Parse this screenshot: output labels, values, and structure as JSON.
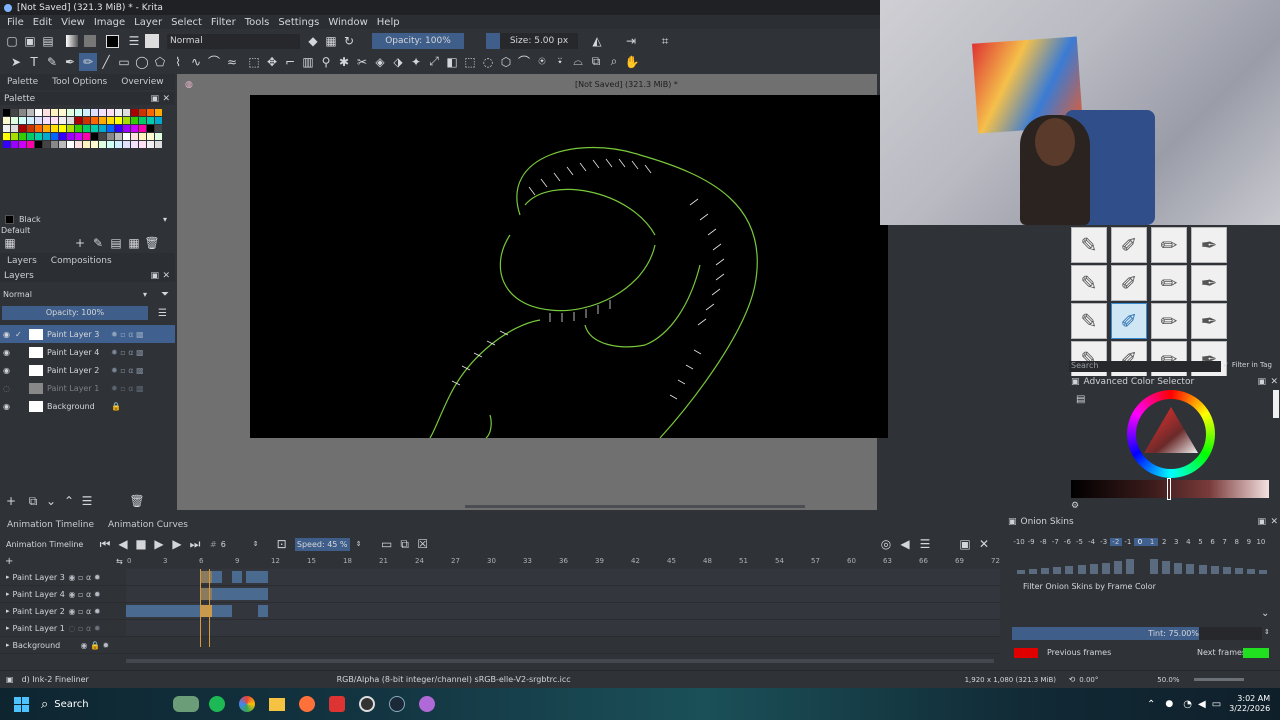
{
  "window": {
    "title": "[Not Saved]  (321.3 MiB) * - Krita"
  },
  "menu": [
    "File",
    "Edit",
    "View",
    "Image",
    "Layer",
    "Select",
    "Filter",
    "Tools",
    "Settings",
    "Window",
    "Help"
  ],
  "toolbar": {
    "blend_mode": "Normal",
    "opacity": "Opacity: 100%",
    "size": "Size: 5.00 px"
  },
  "docker_tabs": [
    "Palette",
    "Tool Options",
    "Overview"
  ],
  "palette": {
    "title": "Palette",
    "current_color": "Black",
    "palette_name": "Default"
  },
  "canvas": {
    "title": "[Not Saved]  (321.3 MiB) *"
  },
  "layers": {
    "tabs": [
      "Layers",
      "Compositions"
    ],
    "blend_mode": "Normal",
    "opacity": "Opacity: 100%",
    "items": [
      {
        "name": "Paint Layer 3",
        "selected": true
      },
      {
        "name": "Paint Layer 4",
        "selected": false
      },
      {
        "name": "Paint Layer 2",
        "selected": false
      },
      {
        "name": "Paint Layer 1",
        "selected": false
      },
      {
        "name": "Background",
        "selected": false
      }
    ]
  },
  "timeline": {
    "tabs": [
      "Animation Timeline",
      "Animation Curves"
    ],
    "title": "Animation Timeline",
    "frame": "6",
    "speed": "Speed: 45 %",
    "ruler": [
      "0",
      "3",
      "6",
      "9",
      "12",
      "15",
      "18",
      "21",
      "24",
      "27",
      "30",
      "33",
      "36",
      "39",
      "42",
      "45",
      "48",
      "51",
      "54",
      "57",
      "60",
      "63",
      "66",
      "69",
      "72"
    ],
    "tracks": [
      "Paint Layer 3",
      "Paint Layer 4",
      "Paint Layer 2",
      "Paint Layer 1",
      "Background"
    ]
  },
  "onion": {
    "title": "Onion Skins",
    "numbers": [
      "-10",
      "-9",
      "-8",
      "-7",
      "-6",
      "-5",
      "-4",
      "-3",
      "-2",
      "-1",
      "0",
      "1",
      "2",
      "3",
      "4",
      "5",
      "6",
      "7",
      "8",
      "9",
      "10"
    ],
    "filter_label": "Filter Onion Skins by Frame Color",
    "tint": "Tint: 75.00%",
    "previous": "Previous frames",
    "next": "Next frames",
    "prev_color": "#e00000",
    "next_color": "#20e020"
  },
  "brush_presets": {
    "search_placeholder": "Search",
    "filter_label": "Filter in Tag"
  },
  "color_selector": {
    "title": "Advanced Color Selector"
  },
  "status": {
    "brush": "d) Ink-2 Fineliner",
    "color_space": "RGB/Alpha (8-bit integer/channel)  sRGB-elle-V2-srgbtrc.icc",
    "dimensions": "1,920 x 1,080 (321.3 MiB)",
    "rotation": "0.00°",
    "zoom": "50.0%"
  },
  "taskbar": {
    "search": "Search",
    "time": "3:02 AM",
    "date": "3/22/2026"
  }
}
